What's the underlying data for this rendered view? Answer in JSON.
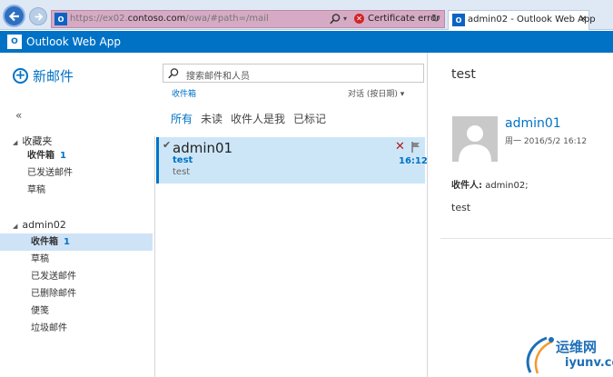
{
  "browser": {
    "url_prefix": "https://ex02.",
    "url_host": "contoso.com",
    "url_path": "/owa/#path=/mail",
    "certificate_error": "Certificate error",
    "tab_title": "admin02 - Outlook Web App",
    "favicon_text": "O"
  },
  "app": {
    "name": "Outlook Web App",
    "accent": "#0072c6"
  },
  "nav": {
    "new_mail": "新邮件",
    "collapse": "«",
    "favorites_label": "收藏夹",
    "favorites": [
      {
        "label": "收件箱",
        "count": "1"
      },
      {
        "label": "已发送邮件"
      },
      {
        "label": "草稿"
      }
    ],
    "account_label": "admin02",
    "account_folders": [
      {
        "label": "收件箱",
        "count": "1"
      },
      {
        "label": "草稿"
      },
      {
        "label": "已发送邮件"
      },
      {
        "label": "已删除邮件"
      },
      {
        "label": "便笺"
      },
      {
        "label": "垃圾邮件"
      }
    ]
  },
  "list": {
    "search_placeholder": "搜索邮件和人员",
    "folder_crumb": "收件箱",
    "sort": "对话 (按日期)",
    "filters": [
      "所有",
      "未读",
      "收件人是我",
      "已标记"
    ],
    "messages": [
      {
        "from": "admin01",
        "subject": "test",
        "preview": "test",
        "time": "16:12"
      }
    ]
  },
  "reading": {
    "subject": "test",
    "from": "admin01",
    "date": "周一 2016/5/2 16:12",
    "to_label": "收件人:",
    "to_value": "admin02;",
    "body": "test"
  },
  "watermark": {
    "line1": "运维网",
    "line2": "iyunv.com"
  }
}
